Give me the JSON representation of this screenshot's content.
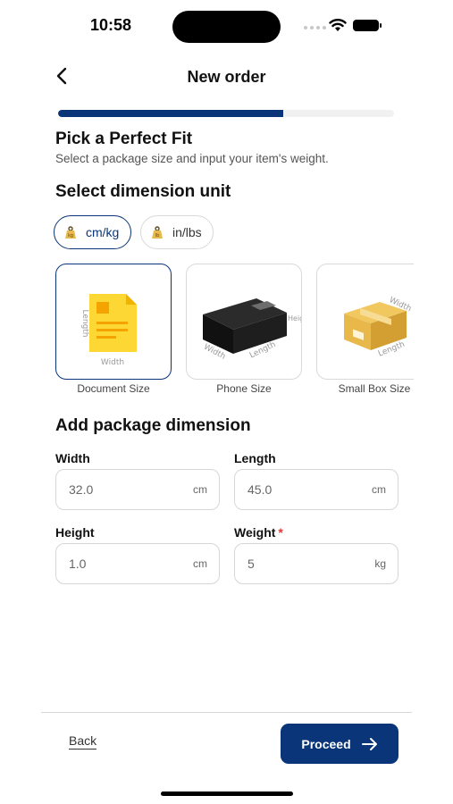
{
  "status_bar": {
    "time": "10:58"
  },
  "header": {
    "title": "New order",
    "back_icon": "chevron-left-icon"
  },
  "progress": {
    "fraction": 0.67
  },
  "intro": {
    "title": "Pick a Perfect Fit",
    "subtitle": "Select a package size and input your item's weight."
  },
  "unit_section": {
    "heading": "Select dimension unit",
    "options": [
      {
        "label": "cm/kg",
        "selected": true,
        "icon": "weight-icon"
      },
      {
        "label": "in/lbs",
        "selected": false,
        "icon": "weight-icon"
      }
    ]
  },
  "packages": [
    {
      "label": "Document Size",
      "selected": true,
      "icon": "document-icon",
      "dims": {
        "width": "Width",
        "length": "Length"
      }
    },
    {
      "label": "Phone Size",
      "selected": false,
      "icon": "phone-box-icon",
      "dims": {
        "width": "Width",
        "length": "Length",
        "height": "Heig"
      }
    },
    {
      "label": "Small Box Size",
      "selected": false,
      "icon": "cardboard-box-icon",
      "dims": {
        "width": "Width",
        "length": "Length"
      }
    }
  ],
  "dimension_section": {
    "heading": "Add package dimension",
    "fields": {
      "width": {
        "label": "Width",
        "value": "32.0",
        "unit": "cm"
      },
      "length": {
        "label": "Length",
        "value": "45.0",
        "unit": "cm"
      },
      "height": {
        "label": "Height",
        "value": "1.0",
        "unit": "cm"
      },
      "weight": {
        "label": "Weight",
        "required_mark": "*",
        "value": "5",
        "unit": "kg"
      }
    }
  },
  "footer": {
    "back_label": "Back",
    "proceed_label": "Proceed",
    "proceed_icon": "arrow-right-icon"
  },
  "colors": {
    "primary": "#0a3579",
    "document_yellow": "#fdd835",
    "box_tan": "#e8b84b",
    "required_red": "#e53935"
  }
}
